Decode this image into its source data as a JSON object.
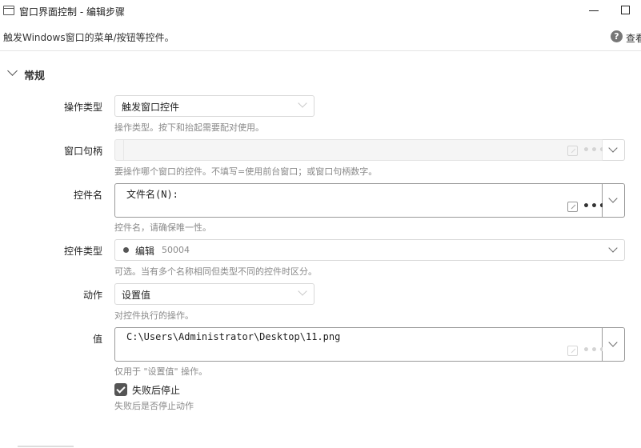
{
  "window": {
    "title": "窗口界面控制  -  编辑步骤",
    "subtitle": "触发Windows窗口的菜单/按钮等控件。",
    "help_label": "查看"
  },
  "section": {
    "title": "常规"
  },
  "fields": {
    "operation_type": {
      "label": "操作类型",
      "value": "触发窗口控件",
      "hint": "操作类型。按下和抬起需要配对使用。"
    },
    "window_handle": {
      "label": "窗口句柄",
      "value": "",
      "hint": "要操作哪个窗口的控件。不填写=使用前台窗口；或窗口句柄数字。"
    },
    "control_name": {
      "label": "控件名",
      "value": "文件名(N):",
      "hint": "控件名，请确保唯一性。"
    },
    "control_type": {
      "label": "控件类型",
      "value": "编辑",
      "code": "50004",
      "hint": "可选。当有多个名称相同但类型不同的控件时区分。"
    },
    "action": {
      "label": "动作",
      "value": "设置值",
      "hint": "对控件执行的操作。"
    },
    "value": {
      "label": "值",
      "value": "C:\\Users\\Administrator\\Desktop\\11.png",
      "hint": "仅用于 \"设置值\" 操作。"
    },
    "stop_on_fail": {
      "label": "失败后停止",
      "checked": true,
      "hint": "失败后是否停止动作"
    }
  }
}
